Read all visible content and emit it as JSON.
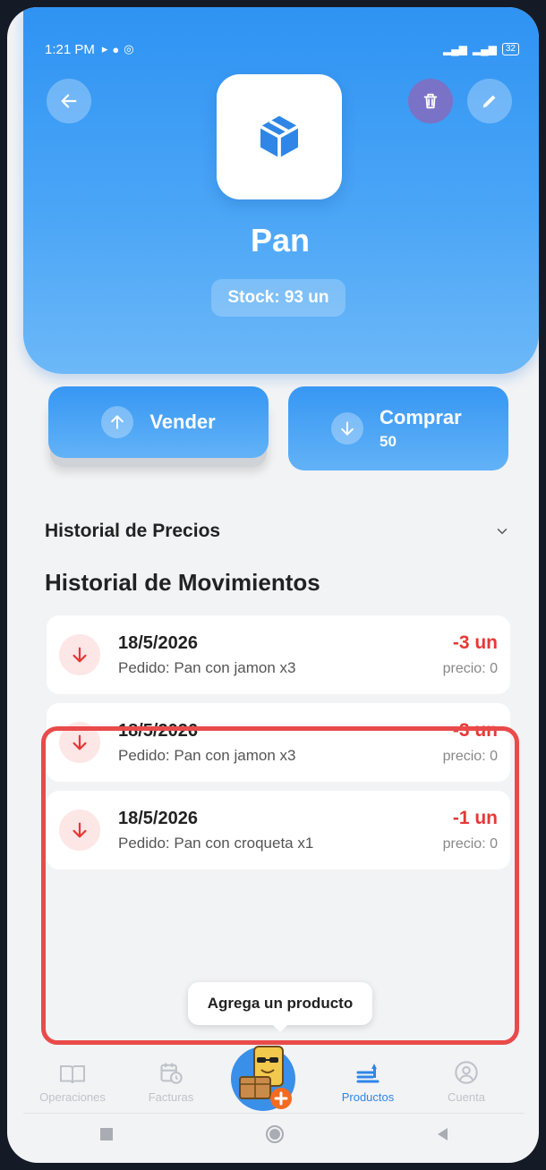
{
  "status_bar": {
    "time": "1:21 PM",
    "battery": "32"
  },
  "header": {
    "product_name": "Pan",
    "stock_label": "Stock: 93 un"
  },
  "actions": {
    "sell_label": "Vender",
    "buy_label": "Comprar",
    "buy_count": "50"
  },
  "sections": {
    "price_history_title": "Historial de Precios",
    "movements_title": "Historial de Movimientos"
  },
  "movements": [
    {
      "date": "18/5/2026",
      "desc": "Pedido: Pan con jamon x3",
      "qty": "-3 un",
      "price": "precio: 0"
    },
    {
      "date": "18/5/2026",
      "desc": "Pedido: Pan con jamon x3",
      "qty": "-3 un",
      "price": "precio: 0"
    },
    {
      "date": "18/5/2026",
      "desc": "Pedido: Pan con croqueta x1",
      "qty": "-1 un",
      "price": "precio: 0"
    }
  ],
  "tooltip": "Agrega un producto",
  "bottom_nav": {
    "operaciones": "Operaciones",
    "facturas": "Facturas",
    "productos": "Productos",
    "cuenta": "Cuenta"
  },
  "colors": {
    "primary": "#2f93f3",
    "danger": "#e53935",
    "highlight": "#e94a4a"
  }
}
